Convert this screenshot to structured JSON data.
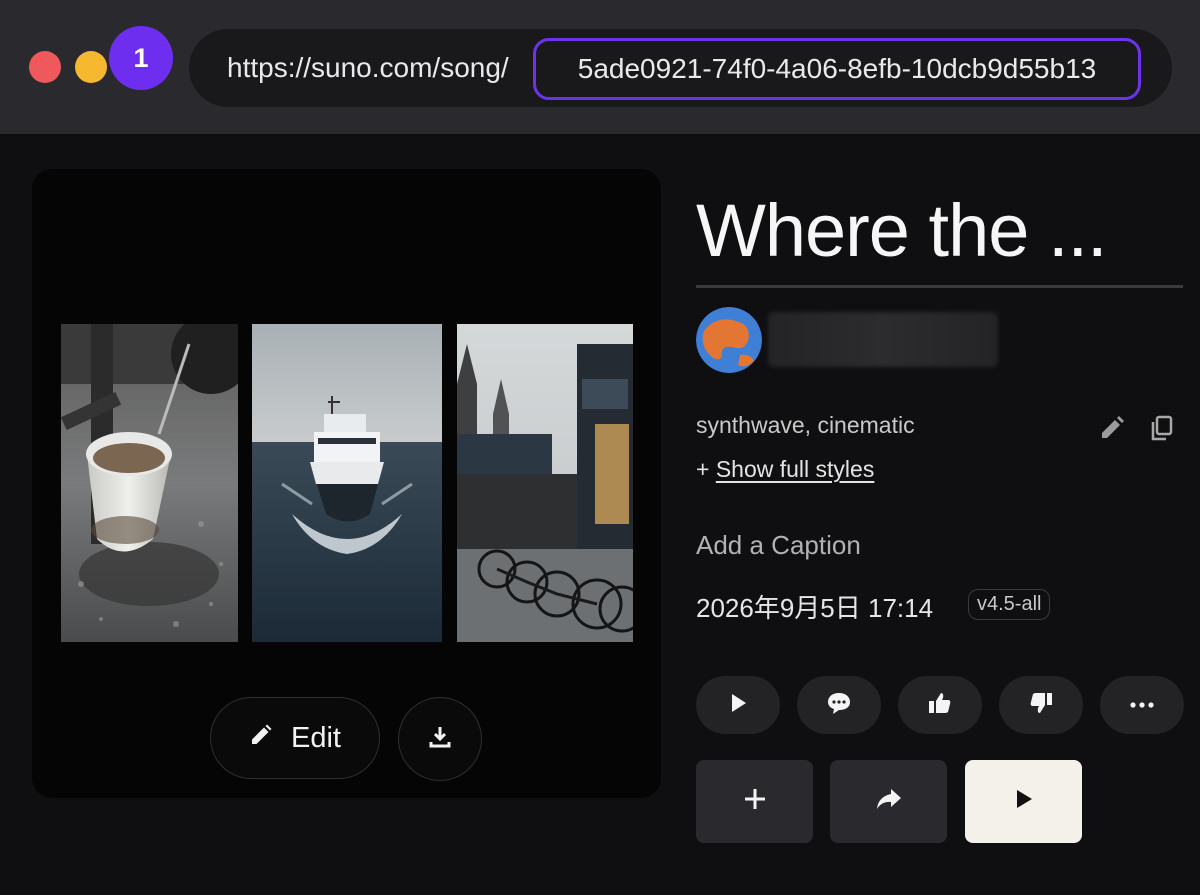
{
  "browser": {
    "url_prefix": "https://suno.com/song/",
    "url_id": "5ade0921-74f0-4a06-8efb-10dcb9d55b13",
    "step_badge": "1"
  },
  "cover": {
    "edit_label": "Edit",
    "panels": [
      "coffee-cup-image",
      "boat-image",
      "street-bicycles-image"
    ]
  },
  "song": {
    "title": "Where the ...",
    "styles": "synthwave, cinematic",
    "show_styles_prefix": "+ ",
    "show_styles_label": "Show full styles",
    "caption_placeholder": "Add a Caption",
    "date": "2026年9月5日 17:14",
    "version": "v4.5-all"
  },
  "colors": {
    "accent": "#6d2ef0",
    "traffic_red": "#f0595b",
    "traffic_yellow": "#f5b82e",
    "primary_button": "#f4f1ea"
  }
}
